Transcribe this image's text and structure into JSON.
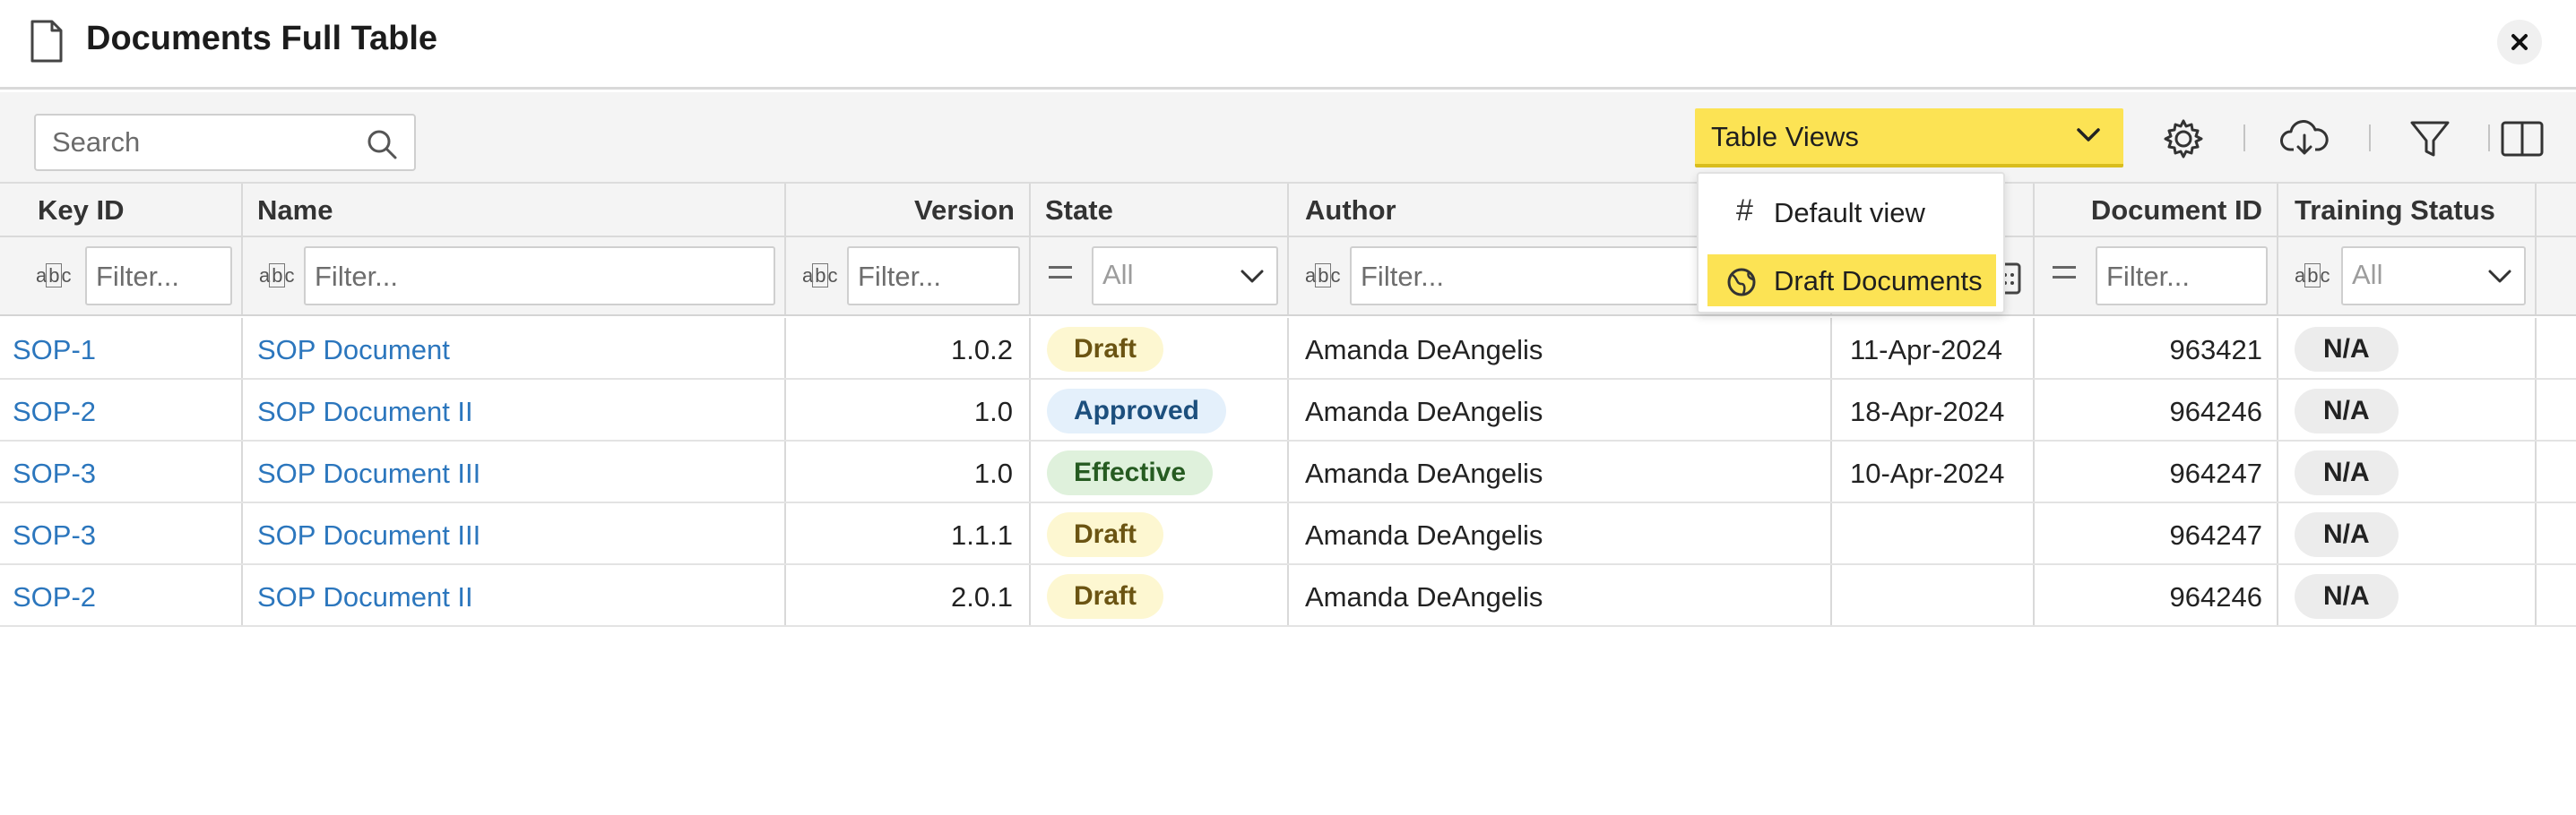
{
  "header": {
    "title": "Documents Full Table"
  },
  "toolbar": {
    "search_placeholder": "Search",
    "table_views_label": "Table Views"
  },
  "views_menu": {
    "items": [
      {
        "label": "Default view",
        "icon": "hash-icon",
        "selected": false
      },
      {
        "label": "Draft Documents",
        "icon": "globe-icon",
        "selected": true
      }
    ]
  },
  "table": {
    "columns": [
      "Key ID",
      "Name",
      "Version",
      "State",
      "Author",
      "",
      "Document ID",
      "Training Status"
    ],
    "filter_placeholder": "Filter...",
    "select_placeholder": "All",
    "rows": [
      {
        "key_id": "SOP-1",
        "name": "SOP Document",
        "version": "1.0.2",
        "state": "Draft",
        "author": "Amanda DeAngelis",
        "date": "11-Apr-2024",
        "document_id": "963421",
        "training_status": "N/A"
      },
      {
        "key_id": "SOP-2",
        "name": "SOP Document II",
        "version": "1.0",
        "state": "Approved",
        "author": "Amanda DeAngelis",
        "date": "18-Apr-2024",
        "document_id": "964246",
        "training_status": "N/A"
      },
      {
        "key_id": "SOP-3",
        "name": "SOP Document III",
        "version": "1.0",
        "state": "Effective",
        "author": "Amanda DeAngelis",
        "date": "10-Apr-2024",
        "document_id": "964247",
        "training_status": "N/A"
      },
      {
        "key_id": "SOP-3",
        "name": "SOP Document III",
        "version": "1.1.1",
        "state": "Draft",
        "author": "Amanda DeAngelis",
        "date": "",
        "document_id": "964247",
        "training_status": "N/A"
      },
      {
        "key_id": "SOP-2",
        "name": "SOP Document II",
        "version": "2.0.1",
        "state": "Draft",
        "author": "Amanda DeAngelis",
        "date": "",
        "document_id": "964246",
        "training_status": "N/A"
      }
    ]
  },
  "colors": {
    "accent_yellow": "#fce354",
    "link_blue": "#2b76bd",
    "draft_bg": "#fdf7d1",
    "approved_bg": "#e4f0fb",
    "effective_bg": "#dff1dc",
    "na_bg": "#ececec"
  }
}
